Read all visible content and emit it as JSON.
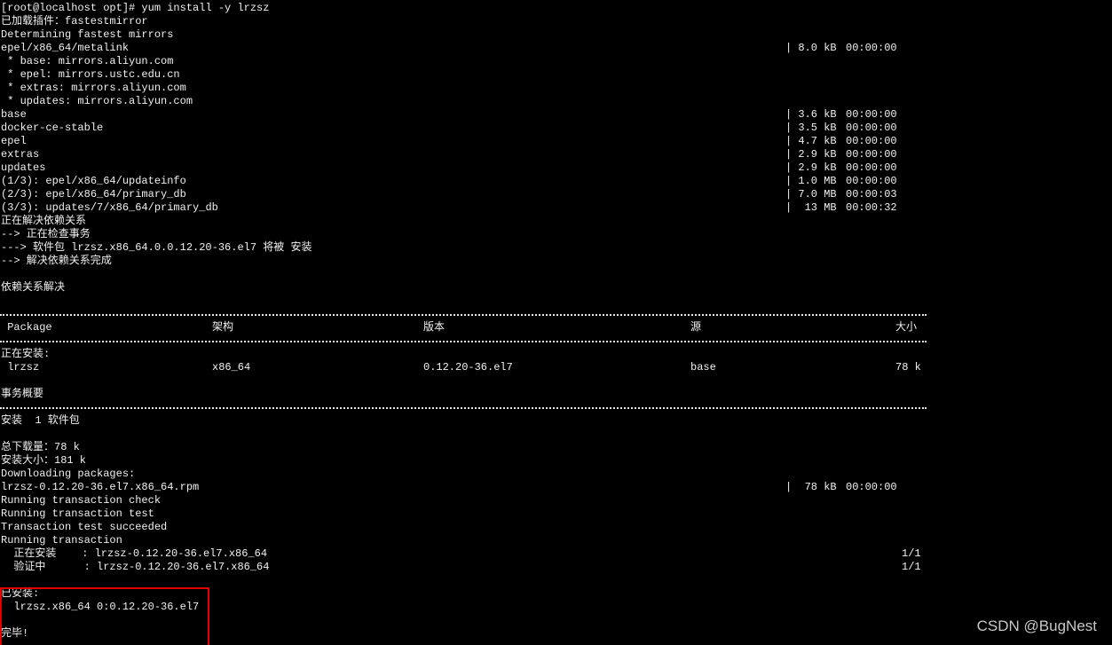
{
  "terminal": {
    "background": "#000000",
    "foreground": "#f0f0f0",
    "highlight_color": "#e00000",
    "header_lines": [
      "[root@localhost opt]# yum install -y lrzsz",
      "已加载插件：fastestmirror",
      "Determining fastest mirrors"
    ],
    "metalink": {
      "name": "epel/x86_64/metalink",
      "size": "| 8.0 kB",
      "time": "00:00:00"
    },
    "mirror_lines": [
      " * base: mirrors.aliyun.com",
      " * epel: mirrors.ustc.edu.cn",
      " * extras: mirrors.aliyun.com",
      " * updates: mirrors.aliyun.com"
    ],
    "repo_rows": [
      {
        "name": "base",
        "size": "| 3.6 kB",
        "time": "00:00:00"
      },
      {
        "name": "docker-ce-stable",
        "size": "| 3.5 kB",
        "time": "00:00:00"
      },
      {
        "name": "epel",
        "size": "| 4.7 kB",
        "time": "00:00:00"
      },
      {
        "name": "extras",
        "size": "| 2.9 kB",
        "time": "00:00:00"
      },
      {
        "name": "updates",
        "size": "| 2.9 kB",
        "time": "00:00:00"
      },
      {
        "name": "(1/3): epel/x86_64/updateinfo",
        "size": "| 1.0 MB",
        "time": "00:00:00"
      },
      {
        "name": "(2/3): epel/x86_64/primary_db",
        "size": "| 7.0 MB",
        "time": "00:00:03"
      },
      {
        "name": "(3/3): updates/7/x86_64/primary_db",
        "size": "|  13 MB",
        "time": "00:00:32"
      }
    ],
    "resolve_lines": [
      "正在解决依赖关系",
      "--> 正在检查事务",
      "---> 软件包 lrzsz.x86_64.0.0.12.20-36.el7 将被 安装",
      "--> 解决依赖关系完成"
    ],
    "resolved_heading": "依赖关系解决",
    "table": {
      "headers": {
        "package": " Package",
        "arch": "架构",
        "version": "版本",
        "repo": "源",
        "size": "大小"
      },
      "installing_label": "正在安装:",
      "row": {
        "package": " lrzsz",
        "arch": "x86_64",
        "version": "0.12.20-36.el7",
        "repo": "base",
        "size": "78 k"
      }
    },
    "summary_heading": "事务概要",
    "install_count_line": "安装  1 软件包",
    "download_size_line": "总下载量：78 k",
    "installed_size_line": "安装大小：181 k",
    "downloading_line": "Downloading packages:",
    "rpm_row": {
      "name": "lrzsz-0.12.20-36.el7.x86_64.rpm",
      "size": "|  78 kB",
      "time": "00:00:00"
    },
    "transaction_lines": [
      "Running transaction check",
      "Running transaction test",
      "Transaction test succeeded",
      "Running transaction"
    ],
    "progress_rows": [
      {
        "label": "  正在安装    : lrzsz-0.12.20-36.el7.x86_64",
        "count": "1/1"
      },
      {
        "label": "  验证中      : lrzsz-0.12.20-36.el7.x86_64",
        "count": "1/1"
      }
    ],
    "installed_heading": "已安装:",
    "installed_package": "  lrzsz.x86_64 0:0.12.20-36.el7",
    "done_line": "完毕!"
  },
  "watermark": "CSDN @BugNest"
}
